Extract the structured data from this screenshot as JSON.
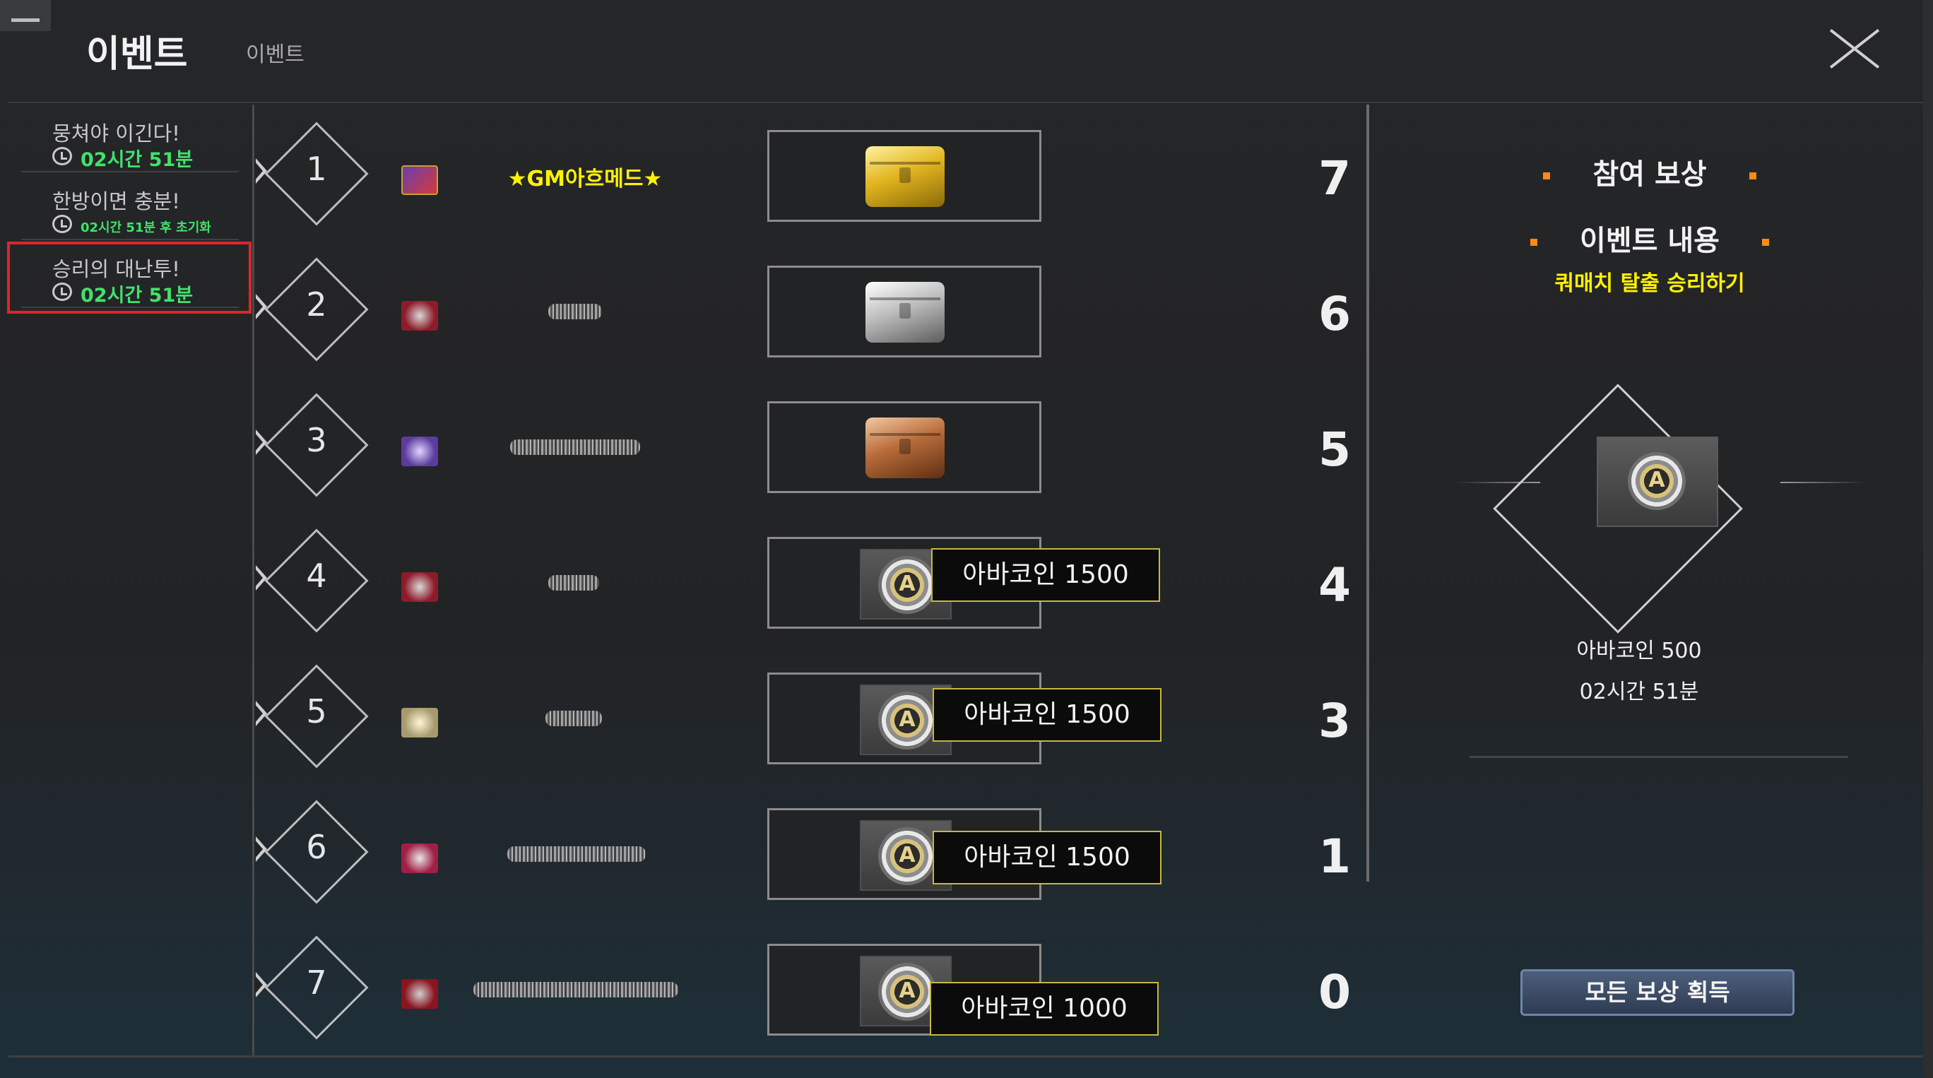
{
  "window": {
    "title": "이벤트",
    "subtitle": "이벤트"
  },
  "sidebar": {
    "items": [
      {
        "title": "뭉쳐야 이긴다!",
        "time": "02시간 51분"
      },
      {
        "title": "한방이면 충분!",
        "time": "02시간 51분 후 초기화"
      },
      {
        "title": "승리의 대난투!",
        "time": "02시간 51분"
      }
    ]
  },
  "rankings": [
    {
      "rank": "1",
      "name": "★GM아흐메드★",
      "reward_type": "gold-chest",
      "reward_label": "",
      "score": "7"
    },
    {
      "rank": "2",
      "name": "",
      "reward_type": "silver-chest",
      "reward_label": "",
      "score": "6"
    },
    {
      "rank": "3",
      "name": "",
      "reward_type": "bronze-chest",
      "reward_label": "",
      "score": "5"
    },
    {
      "rank": "4",
      "name": "",
      "reward_type": "ava-coin",
      "reward_label": "아바코인 1500",
      "score": "4"
    },
    {
      "rank": "5",
      "name": "",
      "reward_type": "ava-coin",
      "reward_label": "아바코인 1500",
      "score": "3"
    },
    {
      "rank": "6",
      "name": "",
      "reward_type": "ava-coin",
      "reward_label": "아바코인 1500",
      "score": "1"
    },
    {
      "rank": "7",
      "name": "",
      "reward_type": "ava-coin",
      "reward_label": "아바코인 1000",
      "score": "0"
    }
  ],
  "right_panel": {
    "participation_header": "참여 보상",
    "event_header": "이벤트 내용",
    "event_description": "쿼매치 탈출 승리하기",
    "reward_name": "아바코인 500",
    "reward_time": "02시간 51분",
    "claim_button": "모든 보상 획득"
  },
  "colors": {
    "accent_yellow": "#fff200",
    "timer_green": "#3fe36a",
    "selected_red": "#e0242b",
    "bullet_orange": "#ff8a14"
  },
  "icons": [
    "minimize-icon",
    "close-icon",
    "clock-icon",
    "rank-emblem-icon",
    "reward-chest-icon",
    "ava-coin-icon"
  ]
}
